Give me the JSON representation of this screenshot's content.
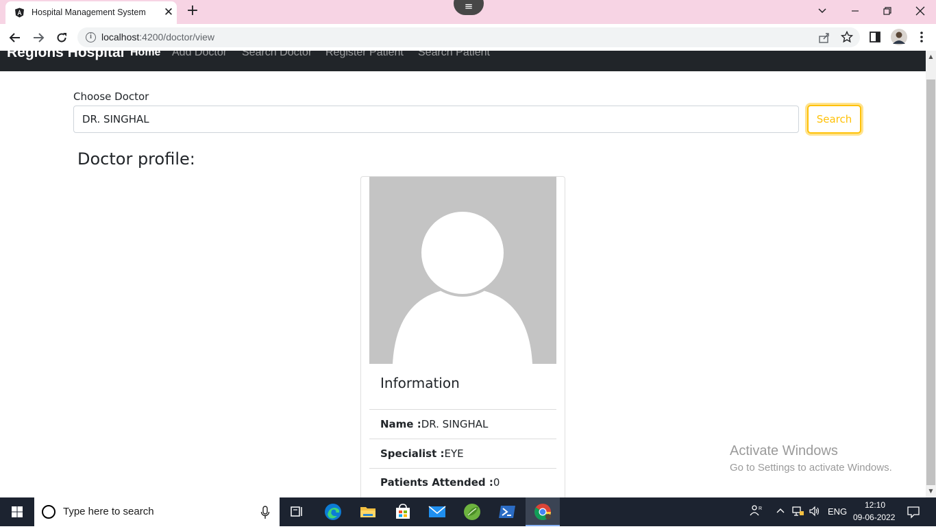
{
  "browser": {
    "tab_title": "Hospital Management System",
    "tab_close": "✕",
    "new_tab": "+",
    "url_host": "localhost",
    "url_path": ":4200/doctor/view",
    "icons": [
      "angular-favicon-icon",
      "back-icon",
      "forward-icon",
      "reload-icon",
      "info-icon",
      "share-icon",
      "star-icon",
      "side-panel-icon",
      "profile-avatar-icon",
      "more-icon",
      "tab-search-icon",
      "minimize-icon",
      "restore-icon",
      "close-window-icon"
    ]
  },
  "navbar": {
    "brand": "Regions Hospital",
    "links": [
      {
        "label": "Home",
        "active": true
      },
      {
        "label": "Add Doctor",
        "active": false
      },
      {
        "label": "Search Doctor",
        "active": false
      },
      {
        "label": "Register Patient",
        "active": false
      },
      {
        "label": "Search Patient",
        "active": false
      }
    ]
  },
  "search": {
    "label": "Choose Doctor",
    "value": "DR. SINGHAL",
    "button_label": "Search",
    "button_color": "#ffc107"
  },
  "profile": {
    "heading": "Doctor profile:",
    "info_title": "Information",
    "rows": [
      {
        "label": "Name :",
        "value": "DR. SINGHAL"
      },
      {
        "label": "Specialist :",
        "value": "EYE"
      },
      {
        "label": "Patients Attended :",
        "value": "0"
      }
    ]
  },
  "watermark": {
    "line1": "Activate Windows",
    "line2": "Go to Settings to activate Windows."
  },
  "taskbar": {
    "search_placeholder": "Type here to search",
    "language": "ENG",
    "time": "12:10",
    "date": "09-06-2022",
    "apps": [
      "task-view-icon",
      "edge-icon",
      "file-explorer-icon",
      "store-icon",
      "mail-icon",
      "spring-tool-icon",
      "powershell-icon",
      "chrome-icon"
    ]
  },
  "colors": {
    "titlebar": "#f7d4e4",
    "navbar": "#212529",
    "taskbar": "#1c2330",
    "avatar_bg": "#c4c4c4"
  }
}
